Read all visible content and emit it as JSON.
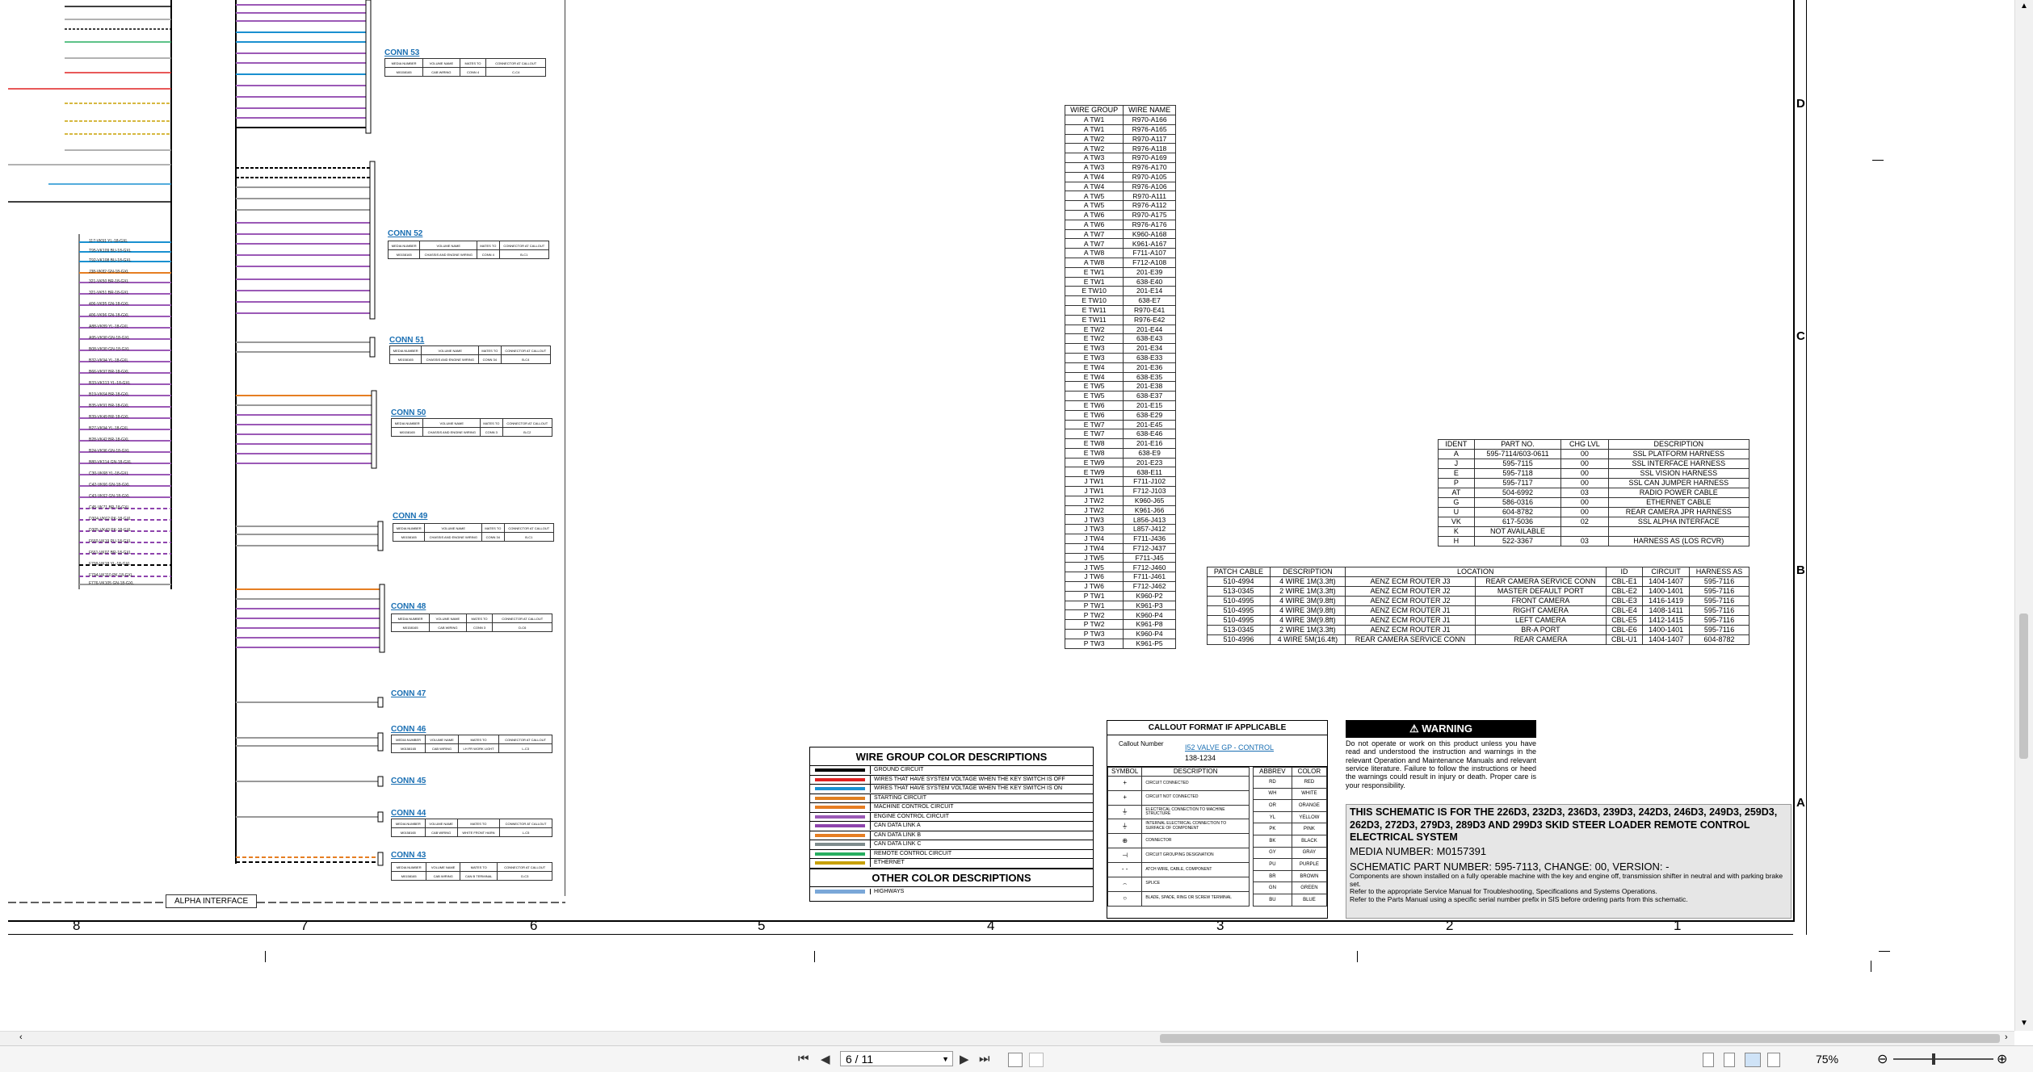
{
  "sheet": {
    "column_numbers": [
      "8",
      "7",
      "6",
      "5",
      "4",
      "3",
      "2",
      "1"
    ],
    "row_letters": [
      "D",
      "C",
      "B",
      "A"
    ],
    "alpha_interface_label": "ALPHA INTERFACE",
    "connectors": [
      {
        "title": "CONN 53",
        "name": "CAB WIRING",
        "mates": "CONN 4",
        "callout": "C-C4"
      },
      {
        "title": "CONN 52",
        "name": "CHASSIS AND ENGINE WIRING",
        "mates": "CONN 4",
        "callout": "B-C1"
      },
      {
        "title": "CONN 51",
        "name": "CHASSIS AND ENGINE WIRING",
        "mates": "CONN 34",
        "callout": "B-C4"
      },
      {
        "title": "CONN 50",
        "name": "CHASSIS AND ENGINE WIRING",
        "mates": "CONN 3",
        "callout": "B-C2"
      },
      {
        "title": "CONN 49",
        "name": "CHASSIS AND ENGINE WIRING",
        "mates": "CONN 34",
        "callout": "B-C1"
      },
      {
        "title": "CONN 48",
        "name": "CAB WIRING",
        "mates": "CONN 3",
        "callout": "D-C6"
      },
      {
        "title": "CONN 47",
        "name": "",
        "mates": "",
        "callout": ""
      },
      {
        "title": "CONN 46",
        "name": "CAB WIRING",
        "mates": "LH FR WORK LIGHT",
        "callout": "L-C3"
      },
      {
        "title": "CONN 45",
        "name": "",
        "mates": "",
        "callout": ""
      },
      {
        "title": "CONN 44",
        "name": "CAB WIRING",
        "mates": "WHITE FRONT HARN",
        "callout": "L-C5"
      },
      {
        "title": "CONN 43",
        "name": "CAB WIRING",
        "mates": "CAN B TERMINAL",
        "callout": "D-C3"
      }
    ],
    "wire_group_table": {
      "headers": [
        "WIRE GROUP",
        "WIRE NAME"
      ],
      "rows": [
        [
          "A TW1",
          "R970-A166"
        ],
        [
          "A TW1",
          "R976-A165"
        ],
        [
          "A TW2",
          "R970-A117"
        ],
        [
          "A TW2",
          "R976-A118"
        ],
        [
          "A TW3",
          "R970-A169"
        ],
        [
          "A TW3",
          "R976-A170"
        ],
        [
          "A TW4",
          "R970-A105"
        ],
        [
          "A TW4",
          "R976-A106"
        ],
        [
          "A TW5",
          "R970-A111"
        ],
        [
          "A TW5",
          "R976-A112"
        ],
        [
          "A TW6",
          "R970-A175"
        ],
        [
          "A TW6",
          "R976-A176"
        ],
        [
          "A TW7",
          "K960-A168"
        ],
        [
          "A TW7",
          "K961-A167"
        ],
        [
          "A TW8",
          "F711-A107"
        ],
        [
          "A TW8",
          "F712-A108"
        ],
        [
          "E TW1",
          "201-E39"
        ],
        [
          "E TW1",
          "638-E40"
        ],
        [
          "E TW10",
          "201-E14"
        ],
        [
          "E TW10",
          "638-E7"
        ],
        [
          "E TW11",
          "R970-E41"
        ],
        [
          "E TW11",
          "R976-E42"
        ],
        [
          "E TW2",
          "201-E44"
        ],
        [
          "E TW2",
          "638-E43"
        ],
        [
          "E TW3",
          "201-E34"
        ],
        [
          "E TW3",
          "638-E33"
        ],
        [
          "E TW4",
          "201-E36"
        ],
        [
          "E TW4",
          "638-E35"
        ],
        [
          "E TW5",
          "201-E38"
        ],
        [
          "E TW5",
          "638-E37"
        ],
        [
          "E TW6",
          "201-E15"
        ],
        [
          "E TW6",
          "638-E29"
        ],
        [
          "E TW7",
          "201-E45"
        ],
        [
          "E TW7",
          "638-E46"
        ],
        [
          "E TW8",
          "201-E16"
        ],
        [
          "E TW8",
          "638-E9"
        ],
        [
          "E TW9",
          "201-E23"
        ],
        [
          "E TW9",
          "638-E11"
        ],
        [
          "J TW1",
          "F711-J102"
        ],
        [
          "J TW1",
          "F712-J103"
        ],
        [
          "J TW2",
          "K960-J65"
        ],
        [
          "J TW2",
          "K961-J66"
        ],
        [
          "J TW3",
          "L856-J413"
        ],
        [
          "J TW3",
          "L857-J412"
        ],
        [
          "J TW4",
          "F711-J436"
        ],
        [
          "J TW4",
          "F712-J437"
        ],
        [
          "J TW5",
          "F711-J45"
        ],
        [
          "J TW5",
          "F712-J460"
        ],
        [
          "J TW6",
          "F711-J461"
        ],
        [
          "J TW6",
          "F712-J462"
        ],
        [
          "P TW1",
          "K960-P2"
        ],
        [
          "P TW1",
          "K961-P3"
        ],
        [
          "P TW2",
          "K960-P4"
        ],
        [
          "P TW2",
          "K961-P8"
        ],
        [
          "P TW3",
          "K960-P4"
        ],
        [
          "P TW3",
          "K961-P5"
        ]
      ]
    },
    "ident_table": {
      "headers": [
        "IDENT",
        "PART NO.",
        "CHG LVL",
        "DESCRIPTION"
      ],
      "rows": [
        [
          "A",
          "595-7114/603-0611",
          "00",
          "SSL PLATFORM HARNESS"
        ],
        [
          "J",
          "595-7115",
          "00",
          "SSL INTERFACE HARNESS"
        ],
        [
          "E",
          "595-7118",
          "00",
          "SSL VISION HARNESS"
        ],
        [
          "P",
          "595-7117",
          "00",
          "SSL CAN JUMPER HARNESS"
        ],
        [
          "AT",
          "504-6992",
          "03",
          "RADIO POWER CABLE"
        ],
        [
          "G",
          "586-0316",
          "00",
          "ETHERNET CABLE"
        ],
        [
          "U",
          "604-8782",
          "00",
          "REAR CAMERA JPR HARNESS"
        ],
        [
          "VK",
          "617-5036",
          "02",
          "SSL ALPHA INTERFACE"
        ],
        [
          "K",
          "NOT AVAILABLE",
          "",
          ""
        ],
        [
          "H",
          "522-3367",
          "03",
          "HARNESS AS (LOS RCVR)"
        ]
      ]
    },
    "patch_table": {
      "headers": [
        "PATCH CABLE",
        "DESCRIPTION",
        "LOCATION",
        "ID",
        "CIRCUIT",
        "HARNESS AS"
      ],
      "rows": [
        [
          "510-4994",
          "4 WIRE 1M(3.3ft)",
          "AENZ ECM ROUTER J3",
          "REAR CAMERA SERVICE CONN",
          "CBL-E1",
          "1404-1407",
          "595-7116"
        ],
        [
          "513-0345",
          "2 WIRE 1M(3.3ft)",
          "AENZ ECM ROUTER J2",
          "MASTER DEFAULT PORT",
          "CBL-E2",
          "1400-1401",
          "595-7116"
        ],
        [
          "510-4995",
          "4 WIRE 3M(9.8ft)",
          "AENZ ECM ROUTER J2",
          "FRONT CAMERA",
          "CBL-E3",
          "1416-1419",
          "595-7116"
        ],
        [
          "510-4995",
          "4 WIRE 3M(9.8ft)",
          "AENZ ECM ROUTER J1",
          "RIGHT CAMERA",
          "CBL-E4",
          "1408-1411",
          "595-7116"
        ],
        [
          "510-4995",
          "4 WIRE 3M(9.8ft)",
          "AENZ ECM ROUTER J1",
          "LEFT CAMERA",
          "CBL-E5",
          "1412-1415",
          "595-7116"
        ],
        [
          "513-0345",
          "2 WIRE 1M(3.3ft)",
          "AENZ ECM ROUTER J1",
          "BR-A PORT",
          "CBL-E6",
          "1400-1401",
          "595-7116"
        ],
        [
          "510-4996",
          "4 WIRE 5M(16.4ft)",
          "REAR CAMERA SERVICE CONN",
          "REAR CAMERA",
          "CBL-U1",
          "1404-1407",
          "604-8782"
        ]
      ]
    },
    "wire_group_colors": {
      "title": "WIRE GROUP COLOR DESCRIPTIONS",
      "items": [
        {
          "label": "GROUND CIRCUIT",
          "color": "#000000"
        },
        {
          "label": "WIRES THAT HAVE SYSTEM VOLTAGE WHEN THE KEY SWITCH IS OFF",
          "color": "#e02020"
        },
        {
          "label": "WIRES THAT HAVE SYSTEM VOLTAGE WHEN THE KEY SWITCH IS ON",
          "color": "#1a90d0"
        },
        {
          "label": "STARTING CIRCUIT",
          "color": "#e08020"
        },
        {
          "label": "MACHINE CONTROL CIRCUIT",
          "color": "#e67e22"
        },
        {
          "label": "ENGINE CONTROL CIRCUIT",
          "color": "#9b59b6"
        },
        {
          "label": "CAN DATA LINK A",
          "color": "#8e44ad"
        },
        {
          "label": "CAN DATA LINK B",
          "color": "#e67e22"
        },
        {
          "label": "CAN DATA LINK C",
          "color": "#7f8c8d"
        },
        {
          "label": "REMOTE CONTROL CIRCUIT",
          "color": "#27ae60"
        },
        {
          "label": "ETHERNET",
          "color": "#c8a000"
        }
      ],
      "other_title": "OTHER COLOR DESCRIPTIONS",
      "other_items": [
        {
          "label": "HIGHWAYS",
          "color": "#7aa7d8"
        }
      ]
    },
    "callout": {
      "title": "CALLOUT FORMAT IF APPLICABLE",
      "callout_number": "Callout Number",
      "link_text": "I52 VALVE GP - CONTROL",
      "wire_example": "138-1234",
      "symbol_header": [
        "SYMBOL",
        "DESCRIPTION"
      ],
      "symbols": [
        "CIRCUIT CONNECTED",
        "CIRCUIT NOT CONNECTED",
        "ELECTRICAL CONNECTION TO MACHINE STRUCTURE",
        "INTERNAL ELECTRICAL CONNECTION TO SURFACE OF COMPONENT",
        "CONNECTOR",
        "CIRCUIT GROUPING DESIGNATION",
        "ATCH WIRE, CABLE, COMPONENT",
        "SPLICE",
        "BLADE, SPADE, RING OR SCREW TERMINAL"
      ],
      "abbrev_header": [
        "ABBREV",
        "COLOR"
      ],
      "abbrevs": [
        [
          "RD",
          "RED"
        ],
        [
          "WH",
          "WHITE"
        ],
        [
          "OR",
          "ORANGE"
        ],
        [
          "YL",
          "YELLOW"
        ],
        [
          "PK",
          "PINK"
        ],
        [
          "BK",
          "BLACK"
        ],
        [
          "GY",
          "GRAY"
        ],
        [
          "PU",
          "PURPLE"
        ],
        [
          "BR",
          "BROWN"
        ],
        [
          "GN",
          "GREEN"
        ],
        [
          "BU",
          "BLUE"
        ]
      ]
    },
    "warning": {
      "title": "WARNING",
      "text": "Do not operate or work on this product unless you have read and understood the instruction and warnings in the relevant Operation and Maintenance Manuals and relevant service literature. Failure to follow the instructions or heed the warnings could result in injury or death. Proper care is your responsibility."
    },
    "title_block": {
      "heading": "THIS SCHEMATIC IS FOR THE 226D3, 232D3, 236D3, 239D3, 242D3, 246D3, 249D3, 259D3, 262D3, 272D3, 279D3, 289D3 AND 299D3 SKID STEER LOADER REMOTE CONTROL ELECTRICAL SYSTEM",
      "media": "MEDIA NUMBER: M0157391",
      "part": "SCHEMATIC PART NUMBER: 595-7113, CHANGE: 00, VERSION: -",
      "note1": "Components are shown installed on a fully operable machine with the key and engine off, transmission shifter in neutral and with parking brake set.",
      "note2": "Refer to the appropriate Service Manual for Troubleshooting, Specifications and Systems Operations.",
      "note3": "Refer to the Parts Manual using a specific serial number prefix in SIS before ordering parts from this schematic."
    }
  },
  "toolbar": {
    "page_value": "6 / 11",
    "zoom": "75%",
    "nav_first": "⏮",
    "nav_prev": "◀",
    "nav_next": "▶",
    "nav_last": "⏭"
  }
}
